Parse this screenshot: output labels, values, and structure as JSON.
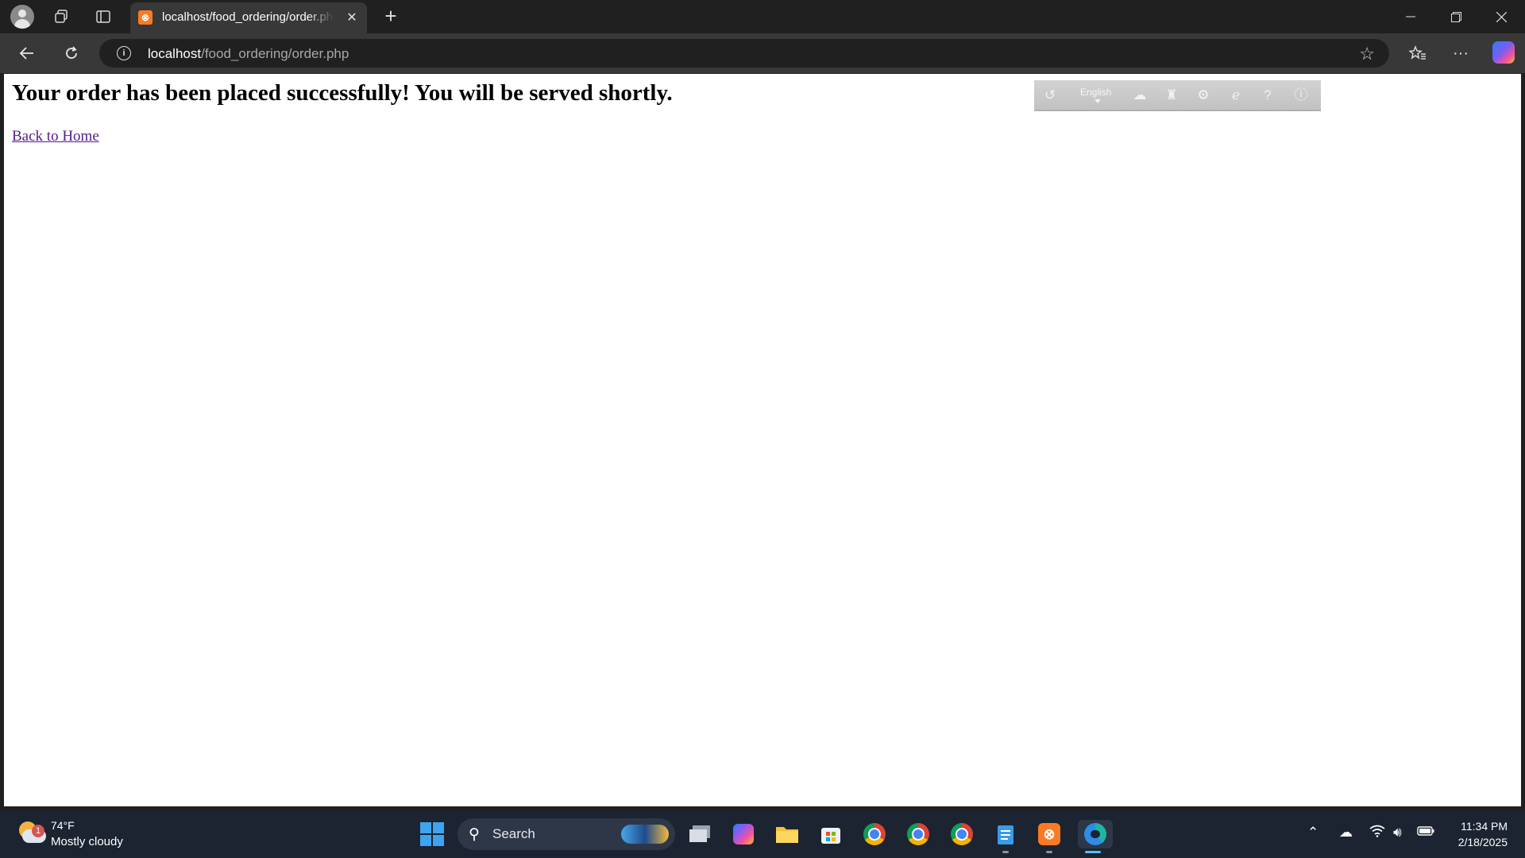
{
  "browser": {
    "tab_title": "localhost/food_ordering/order.php",
    "tab_favicon": "xampp-icon",
    "url_host": "localhost",
    "url_path": "/food_ordering/order.php"
  },
  "page": {
    "message": "Your order has been placed successfully! You will be served shortly.",
    "back_link": "Back to Home"
  },
  "extension_toolbar": {
    "language": "English",
    "icons": [
      "swirl-logo-icon",
      "cloud-icon",
      "chess-piece-icon",
      "gear-icon",
      "internet-explorer-icon",
      "help-icon",
      "info-icon"
    ]
  },
  "taskbar": {
    "weather_temp": "74°F",
    "weather_condition": "Mostly cloudy",
    "weather_badge": "1",
    "search_label": "Search",
    "time": "11:34 PM",
    "date": "2/18/2025",
    "accent_color": "#3ea3f0"
  }
}
